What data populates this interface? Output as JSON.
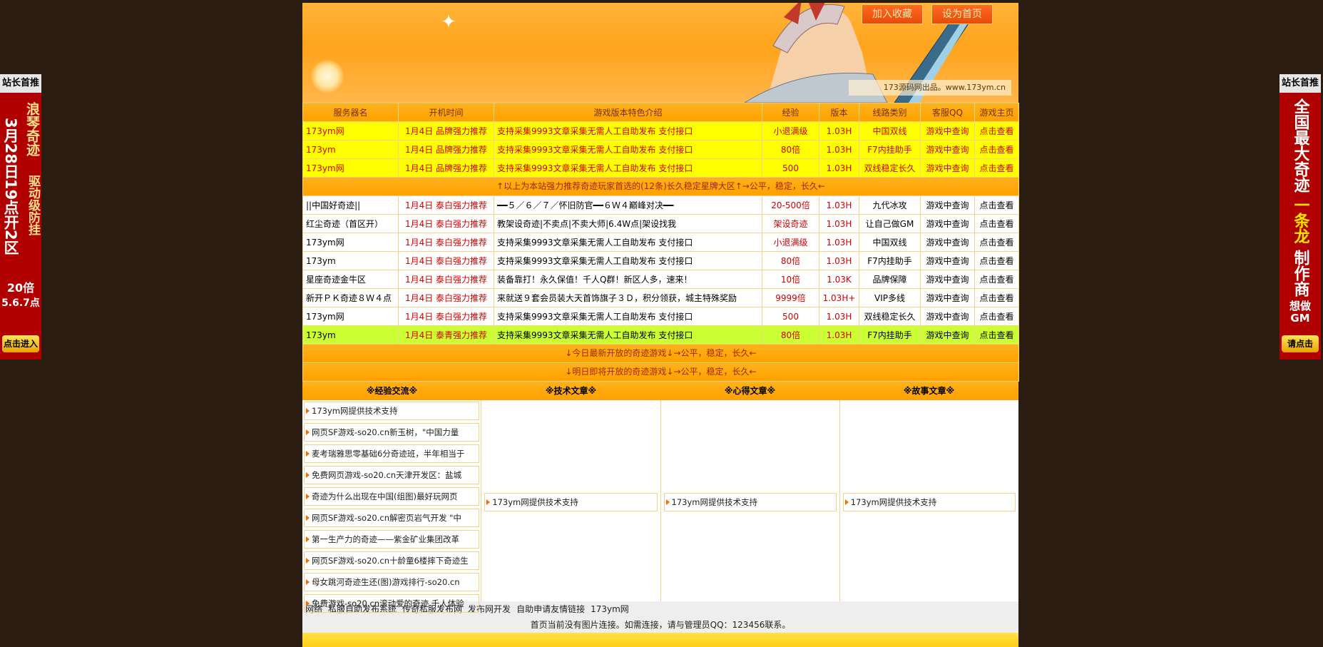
{
  "banner": {
    "fav_button": "加入收藏",
    "home_button": "设为首页",
    "caption": "173源码网出品。www.173ym.cn"
  },
  "table": {
    "headers": [
      "服务器名",
      "开机时间",
      "游戏版本特色介绍",
      "经验",
      "版本",
      "线路类别",
      "客服QQ",
      "游戏主页"
    ],
    "top_rows": [
      [
        "173ym网",
        "1月4日 品牌强力推荐",
        "支持采集9993文章采集无需人工自助发布 支付接口",
        "小退满级",
        "1.03H",
        "中国双线",
        "游戏中查询",
        "点击查看"
      ],
      [
        "173ym",
        "1月4日 品牌强力推荐",
        "支持采集9993文章采集无需人工自助发布 支付接口",
        "80倍",
        "1.03H",
        "F7内挂助手",
        "游戏中查询",
        "点击查看"
      ],
      [
        "173ym网",
        "1月4日 品牌强力推荐",
        "支持采集9993文章采集无需人工自助发布 支付接口",
        "500",
        "1.03H",
        "双线稳定长久",
        "游戏中查询",
        "点击查看"
      ]
    ],
    "sep1": "↑以上为本站强力推荐奇迹玩家首选的(12条)长久稳定星牌大区↑→公平，稳定，长久←",
    "rows": [
      [
        "||中国好奇迹||",
        "1月4日 泰白强力推荐",
        "━━５／６／７／怀旧防官━━６Ｗ４巅峰对决━━",
        "20-500倍",
        "1.03H",
        "九代冰攻",
        "游戏中查询",
        "点击查看"
      ],
      [
        "红尘奇迹（首区开）",
        "1月4日 泰白强力推荐",
        "教架设奇迹|不卖点|不卖大师|6.4W点|架设找我",
        "架设奇迹",
        "1.03H",
        "让自己做GM",
        "游戏中查询",
        "点击查看"
      ],
      [
        "173ym网",
        "1月4日 泰白强力推荐",
        "支持采集9993文章采集无需人工自助发布 支付接口",
        "小退满级",
        "1.03H",
        "中国双线",
        "游戏中查询",
        "点击查看"
      ],
      [
        "173ym",
        "1月4日 泰白强力推荐",
        "支持采集9993文章采集无需人工自助发布 支付接口",
        "80倍",
        "1.03H",
        "F7内挂助手",
        "游戏中查询",
        "点击查看"
      ],
      [
        "星座奇迹金牛区",
        "1月4日 泰白强力推荐",
        "装备靠打！永久保值！千人Q群！新区人多，速来！",
        "10倍",
        "1.03K",
        "品牌保障",
        "游戏中查询",
        "点击查看"
      ],
      [
        "新开ＰＫ奇迹８Ｗ４点",
        "1月4日 泰白强力推荐",
        "来就送９套会员装大天首饰旗子３Ｄ，积分领获，城主特殊奖励",
        "9999倍",
        "1.03H+",
        "VIP多线",
        "游戏中查询",
        "点击查看"
      ],
      [
        "173ym网",
        "1月4日 泰白强力推荐",
        "支持采集9993文章采集无需人工自助发布 支付接口",
        "500",
        "1.03H",
        "双线稳定长久",
        "游戏中查询",
        "点击查看"
      ],
      [
        "173ym",
        "1月4日 泰青强力推荐",
        "支持采集9993文章采集无需人工自助发布 支付接口",
        "80倍",
        "1.03H",
        "F7内挂助手",
        "游戏中查询",
        "点击查看"
      ]
    ],
    "sep2": "↓今日最新开放的奇迹游戏↓→公平，稳定，长久←",
    "sep3": "↓明日即将开放的奇迹游戏↓→公平，稳定，长久←"
  },
  "articles": {
    "headers": [
      "※经验交流※",
      "※技术文章※",
      "※心得文章※",
      "※故事文章※"
    ],
    "exp": [
      "173ym网提供技术支持",
      "网页SF游戏-so20.cn新玉树，\"中国力量",
      "麦考瑞雅思零基础6分奇迹班，半年相当于",
      "免费网页游戏-so20.cn天津开发区：盐城",
      "奇迹为什么出现在中国(组图)最好玩网页",
      "网页SF游戏-so20.cn解密页岩气开发 \"中",
      "第一生产力的奇迹——紫金矿业集团改革",
      "网页SF游戏-so20.cn十龄童6楼摔下奇迹生",
      "母女跳河奇迹生还(图)游戏排行-so20.cn",
      "免费游戏-so20.cn滚动爱的奇迹 千人体验"
    ],
    "tech": "173ym网提供技术支持",
    "xinde": "173ym网提供技术支持",
    "story": "173ym网提供技术支持"
  },
  "friends": [
    "网络",
    "私服自助发布系统",
    "传奇私服发布网",
    "发布网开发",
    "自助申请友情链接",
    "173ym网"
  ],
  "footer": "首页当前没有图片连接。如需连接，请与管理员QQ：123456联系。",
  "left_ad": {
    "header": "站长首推",
    "line1": "3月28日19点开2区",
    "line2": "浪琴奇迹",
    "line3": "驱动级防挂",
    "line4": "20倍",
    "line5": "5.6.7点",
    "button": "点击进入"
  },
  "right_ad": {
    "header": "站长首推",
    "line1": "全国最大奇迹",
    "line2": "一条龙",
    "line3": "制作商",
    "line4": "想做GM",
    "button": "请点击"
  }
}
